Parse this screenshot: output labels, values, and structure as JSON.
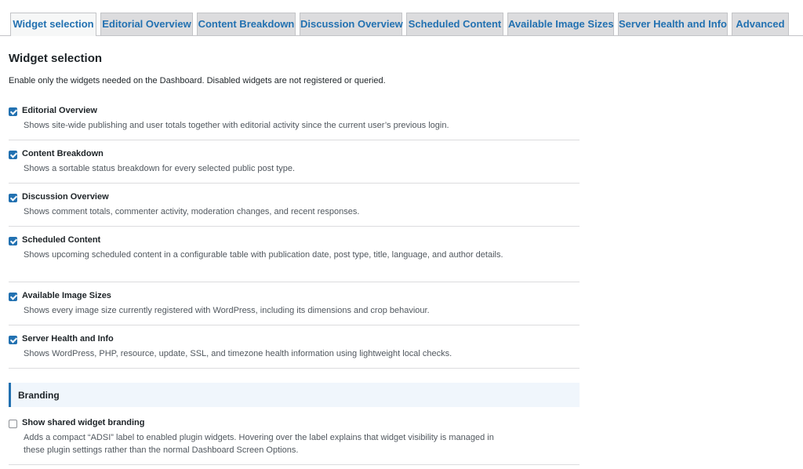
{
  "tabs": [
    {
      "label": "Widget selection",
      "active": true
    },
    {
      "label": "Editorial Overview"
    },
    {
      "label": "Content Breakdown"
    },
    {
      "label": "Discussion Overview"
    },
    {
      "label": "Scheduled Content"
    },
    {
      "label": "Available Image Sizes"
    },
    {
      "label": "Server Health and Info"
    },
    {
      "label": "Advanced"
    }
  ],
  "section": {
    "title": "Widget selection",
    "intro": "Enable only the widgets needed on the Dashboard. Disabled widgets are not registered or queried."
  },
  "widgets": [
    {
      "label": "Editorial Overview",
      "checked": true,
      "desc": "Shows site-wide publishing and user totals together with editorial activity since the current user’s previous login."
    },
    {
      "label": "Content Breakdown",
      "checked": true,
      "desc": "Shows a sortable status breakdown for every selected public post type."
    },
    {
      "label": "Discussion Overview",
      "checked": true,
      "desc": "Shows comment totals, commenter activity, moderation changes, and recent responses."
    },
    {
      "label": "Scheduled Content",
      "checked": true,
      "desc": "Shows upcoming scheduled content in a configurable table with publication date, post type, title, language, and author details."
    },
    {
      "label": "Available Image Sizes",
      "checked": true,
      "desc": "Shows every image size currently registered with WordPress, including its dimensions and crop behaviour."
    },
    {
      "label": "Server Health and Info",
      "checked": true,
      "desc": "Shows WordPress, PHP, resource, update, SSL, and timezone health information using lightweight local checks."
    }
  ],
  "branding": {
    "title": "Branding",
    "option": {
      "label": "Show shared widget branding",
      "checked": false,
      "desc": "Adds a compact “ADSI” label to enabled plugin widgets. Hovering over the label explains that widget visibility is managed in these plugin settings rather than the normal Dashboard Screen Options."
    }
  },
  "colors": {
    "accent": "#2271b1",
    "tab_bg": "#dcdcde",
    "branding_bg": "#f0f6fc"
  }
}
